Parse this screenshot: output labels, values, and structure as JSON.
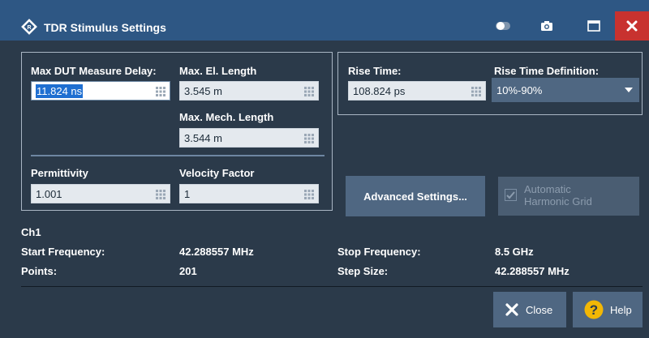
{
  "window": {
    "title": "TDR Stimulus Settings"
  },
  "icons": {
    "app": "rohde-schwarz-logo-icon",
    "toggle": "toggle-icon",
    "camera": "camera-icon",
    "maximize": "maximize-icon",
    "close": "close-icon",
    "keypad": "keypad-icon",
    "dropdown": "chevron-down-icon",
    "help": "question-icon",
    "close_x": "x-icon"
  },
  "colors": {
    "titlebar": "#2e5784",
    "background": "#2b3a4a",
    "close_button": "#c8322f",
    "button": "#4f6782",
    "help_icon": "#f2b705"
  },
  "left_panel": {
    "max_dut_delay": {
      "label": "Max DUT Measure Delay:",
      "value": "11.824 ns",
      "focused": true,
      "selected": true
    },
    "max_el_length": {
      "label": "Max. El. Length",
      "value": "3.545 m"
    },
    "max_mech_length": {
      "label": "Max. Mech. Length",
      "value": "3.544 m"
    },
    "permittivity": {
      "label": "Permittivity",
      "value": "1.001"
    },
    "velocity_factor": {
      "label": "Velocity Factor",
      "value": "1"
    }
  },
  "right_panel": {
    "rise_time": {
      "label": "Rise Time:",
      "value": "108.824 ps"
    },
    "rise_time_definition": {
      "label": "Rise Time Definition:",
      "value": "10%-90%"
    }
  },
  "advanced_button": {
    "label": "Advanced Settings..."
  },
  "automatic_harmonic_grid": {
    "line1": "Automatic",
    "line2": "Harmonic Grid",
    "checked": true,
    "enabled": false
  },
  "info": {
    "channel": "Ch1",
    "start_frequency_label": "Start Frequency:",
    "start_frequency": "42.288557 MHz",
    "stop_frequency_label": "Stop Frequency:",
    "stop_frequency": "8.5 GHz",
    "points_label": "Points:",
    "points": "201",
    "step_size_label": "Step Size:",
    "step_size": "42.288557 MHz"
  },
  "buttons": {
    "close": "Close",
    "help": "Help"
  }
}
